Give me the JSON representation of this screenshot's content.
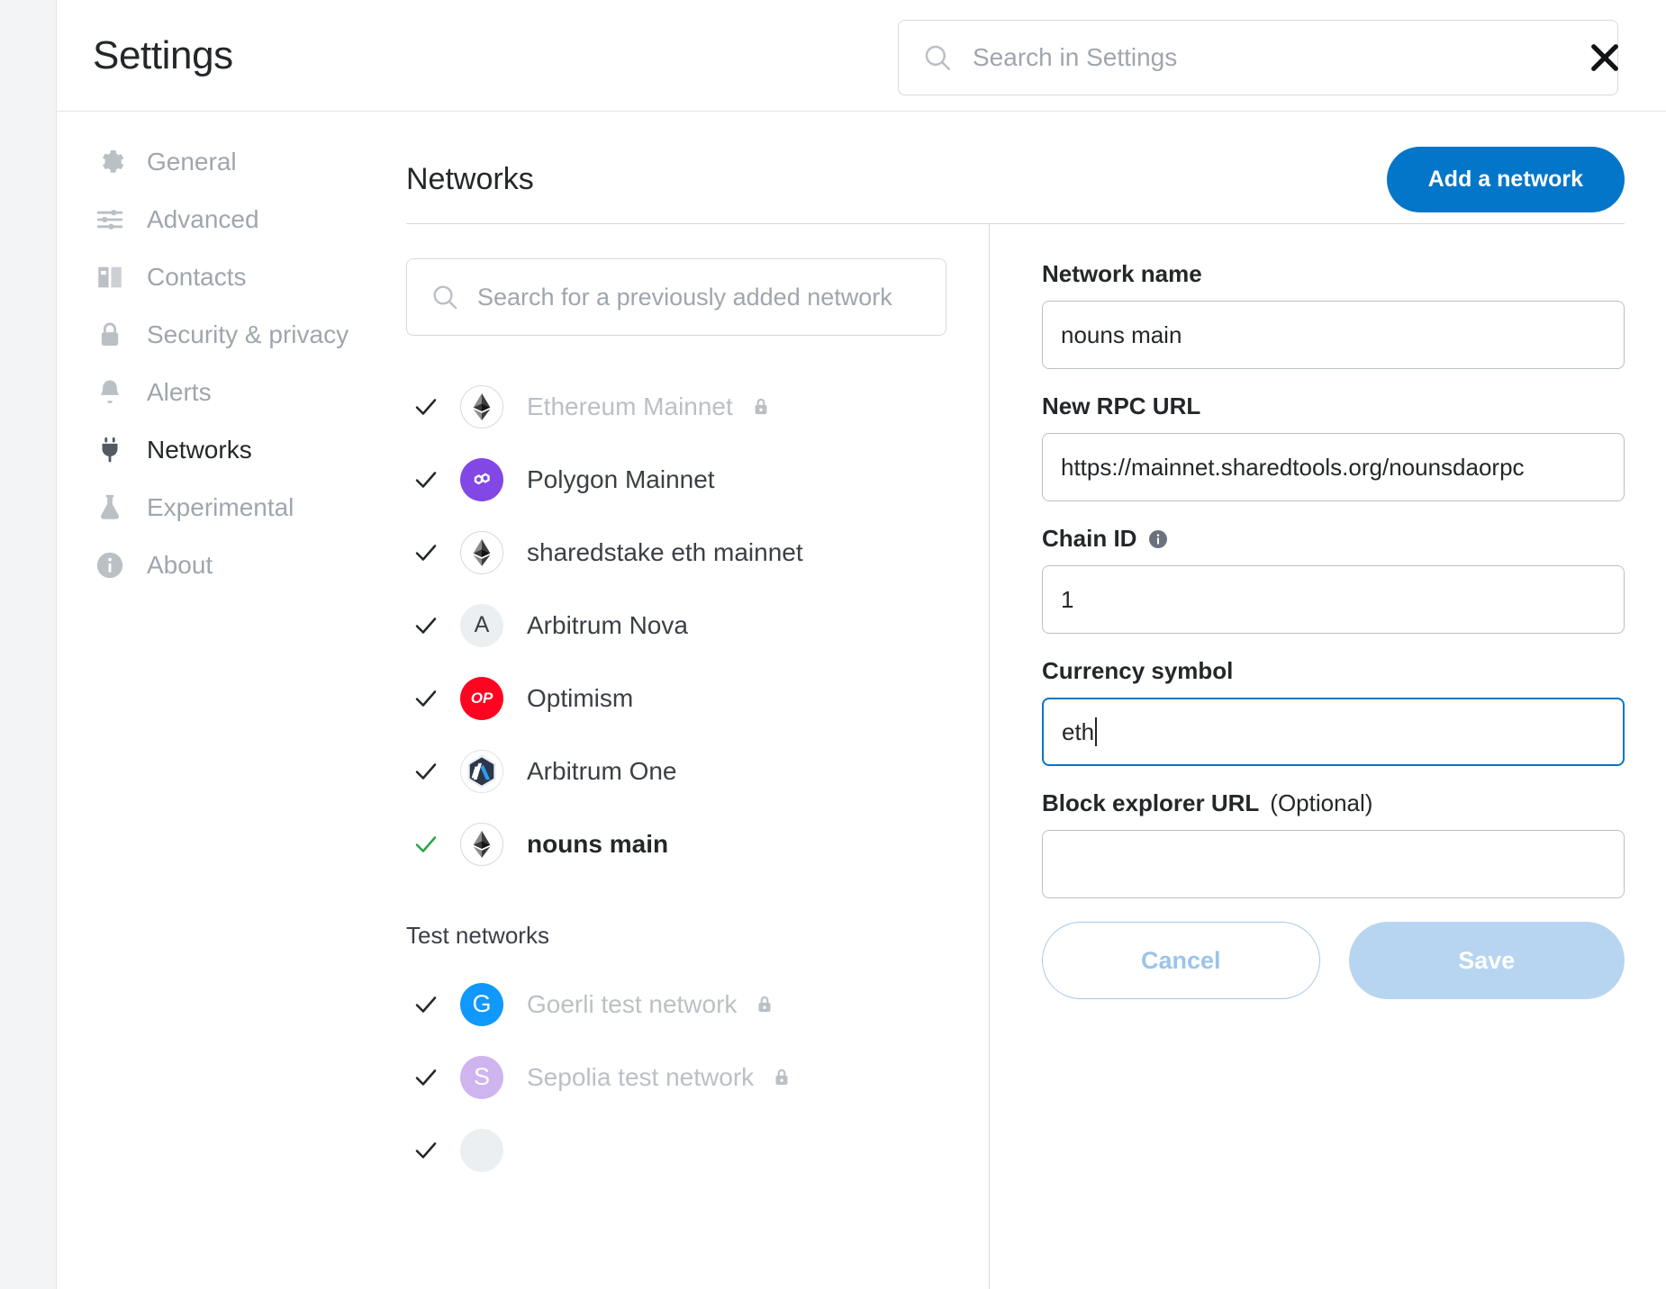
{
  "header": {
    "title": "Settings",
    "search_placeholder": "Search in Settings",
    "search_value": "",
    "search_icon": "search-icon",
    "close_icon": "close-icon"
  },
  "sidebar": {
    "items": [
      {
        "label": "General",
        "icon": "gear-icon",
        "active": false
      },
      {
        "label": "Advanced",
        "icon": "sliders-icon",
        "active": false
      },
      {
        "label": "Contacts",
        "icon": "book-icon",
        "active": false
      },
      {
        "label": "Security & privacy",
        "icon": "lock-icon",
        "active": false
      },
      {
        "label": "Alerts",
        "icon": "bell-icon",
        "active": false
      },
      {
        "label": "Networks",
        "icon": "plug-icon",
        "active": true
      },
      {
        "label": "Experimental",
        "icon": "flask-icon",
        "active": false
      },
      {
        "label": "About",
        "icon": "info-icon",
        "active": false
      }
    ]
  },
  "main": {
    "title": "Networks",
    "add_network_label": "Add a network"
  },
  "network_list": {
    "search_placeholder": "Search for a previously added network",
    "search_icon": "search-icon",
    "test_section_label": "Test networks",
    "networks": [
      {
        "name": "Ethereum Mainnet",
        "logo": "ethereum-logo",
        "locked": true,
        "muted": true,
        "current": false,
        "check": "check-icon"
      },
      {
        "name": "Polygon Mainnet",
        "logo": "polygon-logo",
        "locked": false,
        "muted": false,
        "current": false,
        "check": "check-icon"
      },
      {
        "name": "sharedstake eth mainnet",
        "logo": "ethereum-logo",
        "locked": false,
        "muted": false,
        "current": false,
        "check": "check-icon"
      },
      {
        "name": "Arbitrum Nova",
        "logo": "letter-a-logo",
        "locked": false,
        "muted": false,
        "current": false,
        "check": "check-icon"
      },
      {
        "name": "Optimism",
        "logo": "optimism-logo",
        "locked": false,
        "muted": false,
        "current": false,
        "check": "check-icon"
      },
      {
        "name": "Arbitrum One",
        "logo": "arbitrum-logo",
        "locked": false,
        "muted": false,
        "current": false,
        "check": "check-icon"
      },
      {
        "name": "nouns main",
        "logo": "ethereum-logo",
        "locked": false,
        "muted": false,
        "current": true,
        "check": "check-icon-green"
      }
    ],
    "test_networks": [
      {
        "name": "Goerli test network",
        "logo": "goerli-logo",
        "letter": "G",
        "locked": true,
        "muted": true,
        "check": "check-icon"
      },
      {
        "name": "Sepolia test network",
        "logo": "sepolia-logo",
        "letter": "S",
        "locked": true,
        "muted": true,
        "check": "check-icon"
      }
    ]
  },
  "form": {
    "network_name_label": "Network name",
    "network_name_value": "nouns main",
    "rpc_url_label": "New RPC URL",
    "rpc_url_value": "https://mainnet.sharedtools.org/nounsdaorpc",
    "chain_id_label": "Chain ID",
    "chain_id_info_icon": "info-icon",
    "chain_id_value": "1",
    "currency_symbol_label": "Currency symbol",
    "currency_symbol_value": "eth",
    "block_explorer_label": "Block explorer URL",
    "block_explorer_optional": "(Optional)",
    "block_explorer_value": "",
    "cancel_label": "Cancel",
    "save_label": "Save"
  },
  "colors": {
    "accent": "#0376c9",
    "save_disabled": "#b7d5f0",
    "active_check": "#28a745",
    "polygon": "#8247e5",
    "optimism": "#ff0420",
    "goerli": "#1098fc",
    "sepolia": "#cfb5f0"
  }
}
